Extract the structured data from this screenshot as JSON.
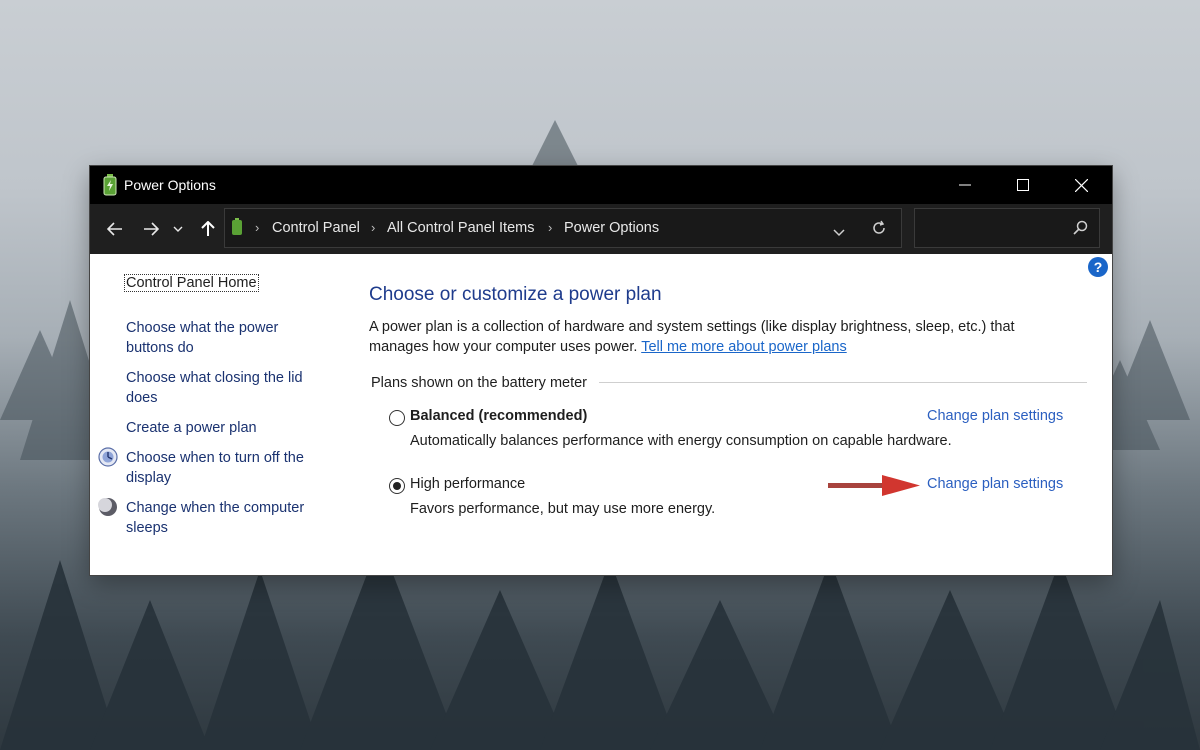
{
  "window": {
    "title": "Power Options",
    "icon": "battery-icon"
  },
  "address_bar": {
    "breadcrumbs": [
      "Control Panel",
      "All Control Panel Items",
      "Power Options"
    ],
    "search_placeholder": ""
  },
  "sidebar": {
    "home_label": "Control Panel Home",
    "items": [
      {
        "label": "Choose what the power buttons do"
      },
      {
        "label": "Choose what closing the lid does"
      },
      {
        "label": "Create a power plan"
      },
      {
        "label": "Choose when to turn off the display",
        "icon": "monitor-icon"
      },
      {
        "label": "Change when the computer sleeps",
        "icon": "moon-icon"
      }
    ]
  },
  "main": {
    "heading": "Choose or customize a power plan",
    "description": "A power plan is a collection of hardware and system settings (like display brightness, sleep, etc.) that manages how your computer uses power.",
    "learn_more_link": "Tell me more about power plans",
    "group_label": "Plans shown on the battery meter",
    "plans": [
      {
        "name": "Balanced (recommended)",
        "description": "Automatically balances performance with energy consumption on capable hardware.",
        "link": "Change plan settings",
        "selected": false
      },
      {
        "name": "High performance",
        "description": "Favors performance, but may use more energy.",
        "link": "Change plan settings",
        "selected": true
      }
    ]
  },
  "colors": {
    "titlebar": "#000000",
    "addressbar": "#1f1f1f",
    "heading": "#1e3b8c",
    "link": "#2b5fc0",
    "annotation_arrow": "#c9302c"
  }
}
